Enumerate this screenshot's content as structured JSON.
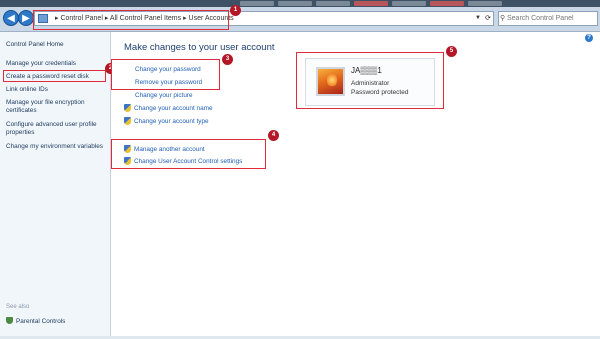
{
  "address_bar": {
    "breadcrumbs": [
      "Control Panel",
      "All Control Panel Items",
      "User Accounts"
    ],
    "separator": "▸",
    "search_placeholder": "Search Control Panel"
  },
  "sidebar": {
    "home": "Control Panel Home",
    "links": [
      "Manage your credentials",
      "Create a password reset disk",
      "Link online IDs",
      "Manage your file encryption certificates",
      "Configure advanced user profile properties",
      "Change my environment variables"
    ],
    "see_also_label": "See also",
    "see_also_links": [
      "Parental Controls"
    ]
  },
  "main": {
    "heading": "Make changes to your user account",
    "tasks_group1": [
      "Change your password",
      "Remove your password",
      "Change your picture",
      "Change your account name",
      "Change your account type"
    ],
    "tasks_group2": [
      "Manage another account",
      "Change User Account Control settings"
    ]
  },
  "account": {
    "name": "JA▒▒▒1",
    "type": "Administrator",
    "status": "Password protected"
  },
  "annotations": [
    "1",
    "2",
    "3",
    "4",
    "5"
  ],
  "colors": {
    "link": "#1f5fb6",
    "heading": "#1e3f72",
    "annotation": "#e02b3a",
    "badge": "#b31728"
  },
  "icons": {
    "back": "back-arrow-icon",
    "forward": "forward-arrow-icon",
    "shield": "uac-shield-icon",
    "help": "help-icon",
    "search": "search-icon"
  }
}
